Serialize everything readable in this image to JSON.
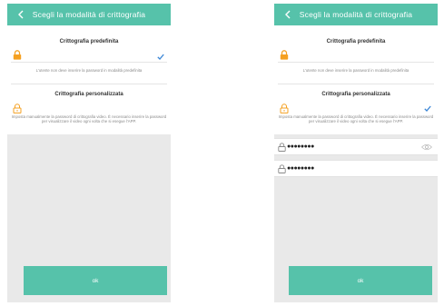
{
  "colors": {
    "accent": "#56c2aa",
    "lock_orange": "#f5a020",
    "check_blue": "#3a86d6",
    "gray_bg": "#e9e9e9"
  },
  "icons": {
    "back": "chevron-left-icon",
    "option_lock": "lock-icon",
    "selected": "checkmark-icon",
    "password_lock": "lock-outline-icon",
    "visibility": "eye-icon"
  },
  "screens": [
    {
      "header": {
        "title": "Scegli la modalità di crittografia"
      },
      "options": [
        {
          "title": "Crittografia predefinita",
          "description": "L'utente non deve inserire la password in modalità predefinita",
          "selected": true
        },
        {
          "title": "Crittografia personalizzata",
          "description": "Imposta manualmente la password di crittografia video. È necessario inserire la password per visualizzare il video ogni volta che si esegue l'APP.",
          "selected": false
        }
      ],
      "ok_label": "ok"
    },
    {
      "header": {
        "title": "Scegli la modalità di crittografia"
      },
      "options": [
        {
          "title": "Crittografia predefinita",
          "description": "L'utente non deve inserire la password in modalità predefinita",
          "selected": false
        },
        {
          "title": "Crittografia personalizzata",
          "description": "Imposta manualmente la password di crittografia video. È necessario inserire la password per visualizzare il video ogni volta che si esegue l'APP.",
          "selected": true
        }
      ],
      "password_fields": [
        {
          "value": "●●●●●●●●"
        },
        {
          "value": "●●●●●●●●"
        }
      ],
      "ok_label": "ok"
    }
  ]
}
